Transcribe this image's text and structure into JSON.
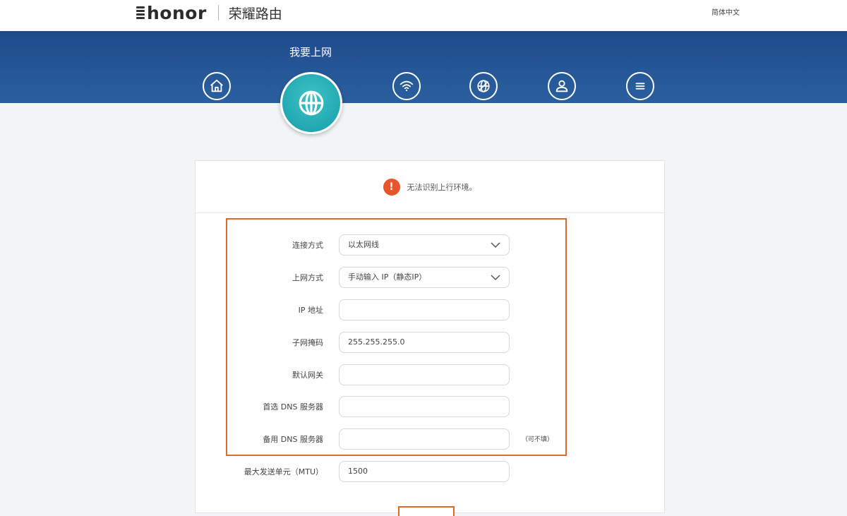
{
  "header": {
    "brand": "honor",
    "product_title": "荣耀路由",
    "lang_link": "简体中文"
  },
  "nav": {
    "active_label": "我要上网",
    "items": [
      {
        "name": "home",
        "icon": "home-icon"
      },
      {
        "name": "internet",
        "icon": "globe-icon",
        "active": true
      },
      {
        "name": "wifi",
        "icon": "wifi-icon"
      },
      {
        "name": "devices",
        "icon": "globe-net-icon"
      },
      {
        "name": "account",
        "icon": "person-icon"
      },
      {
        "name": "more",
        "icon": "menu-icon"
      }
    ]
  },
  "status": {
    "message": "无法识别上行环境。",
    "color": "#e8542b"
  },
  "form": {
    "connection_type": {
      "label": "连接方式",
      "value": "以太网线"
    },
    "access_mode": {
      "label": "上网方式",
      "value": "手动输入 IP（静态IP）"
    },
    "ip_address": {
      "label": "IP 地址",
      "value": ""
    },
    "subnet_mask": {
      "label": "子网掩码",
      "value": "255.255.255.0"
    },
    "gateway": {
      "label": "默认网关",
      "value": ""
    },
    "primary_dns": {
      "label": "首选 DNS 服务器",
      "value": ""
    },
    "secondary_dns": {
      "label": "备用 DNS 服务器",
      "value": "",
      "note": "（可不填）"
    },
    "mtu": {
      "label": "最大发送单元（MTU）",
      "value": "1500"
    }
  },
  "colors": {
    "nav_band": "#255796",
    "active_nav": "#22a8b0",
    "highlight": "#e06a2c"
  }
}
